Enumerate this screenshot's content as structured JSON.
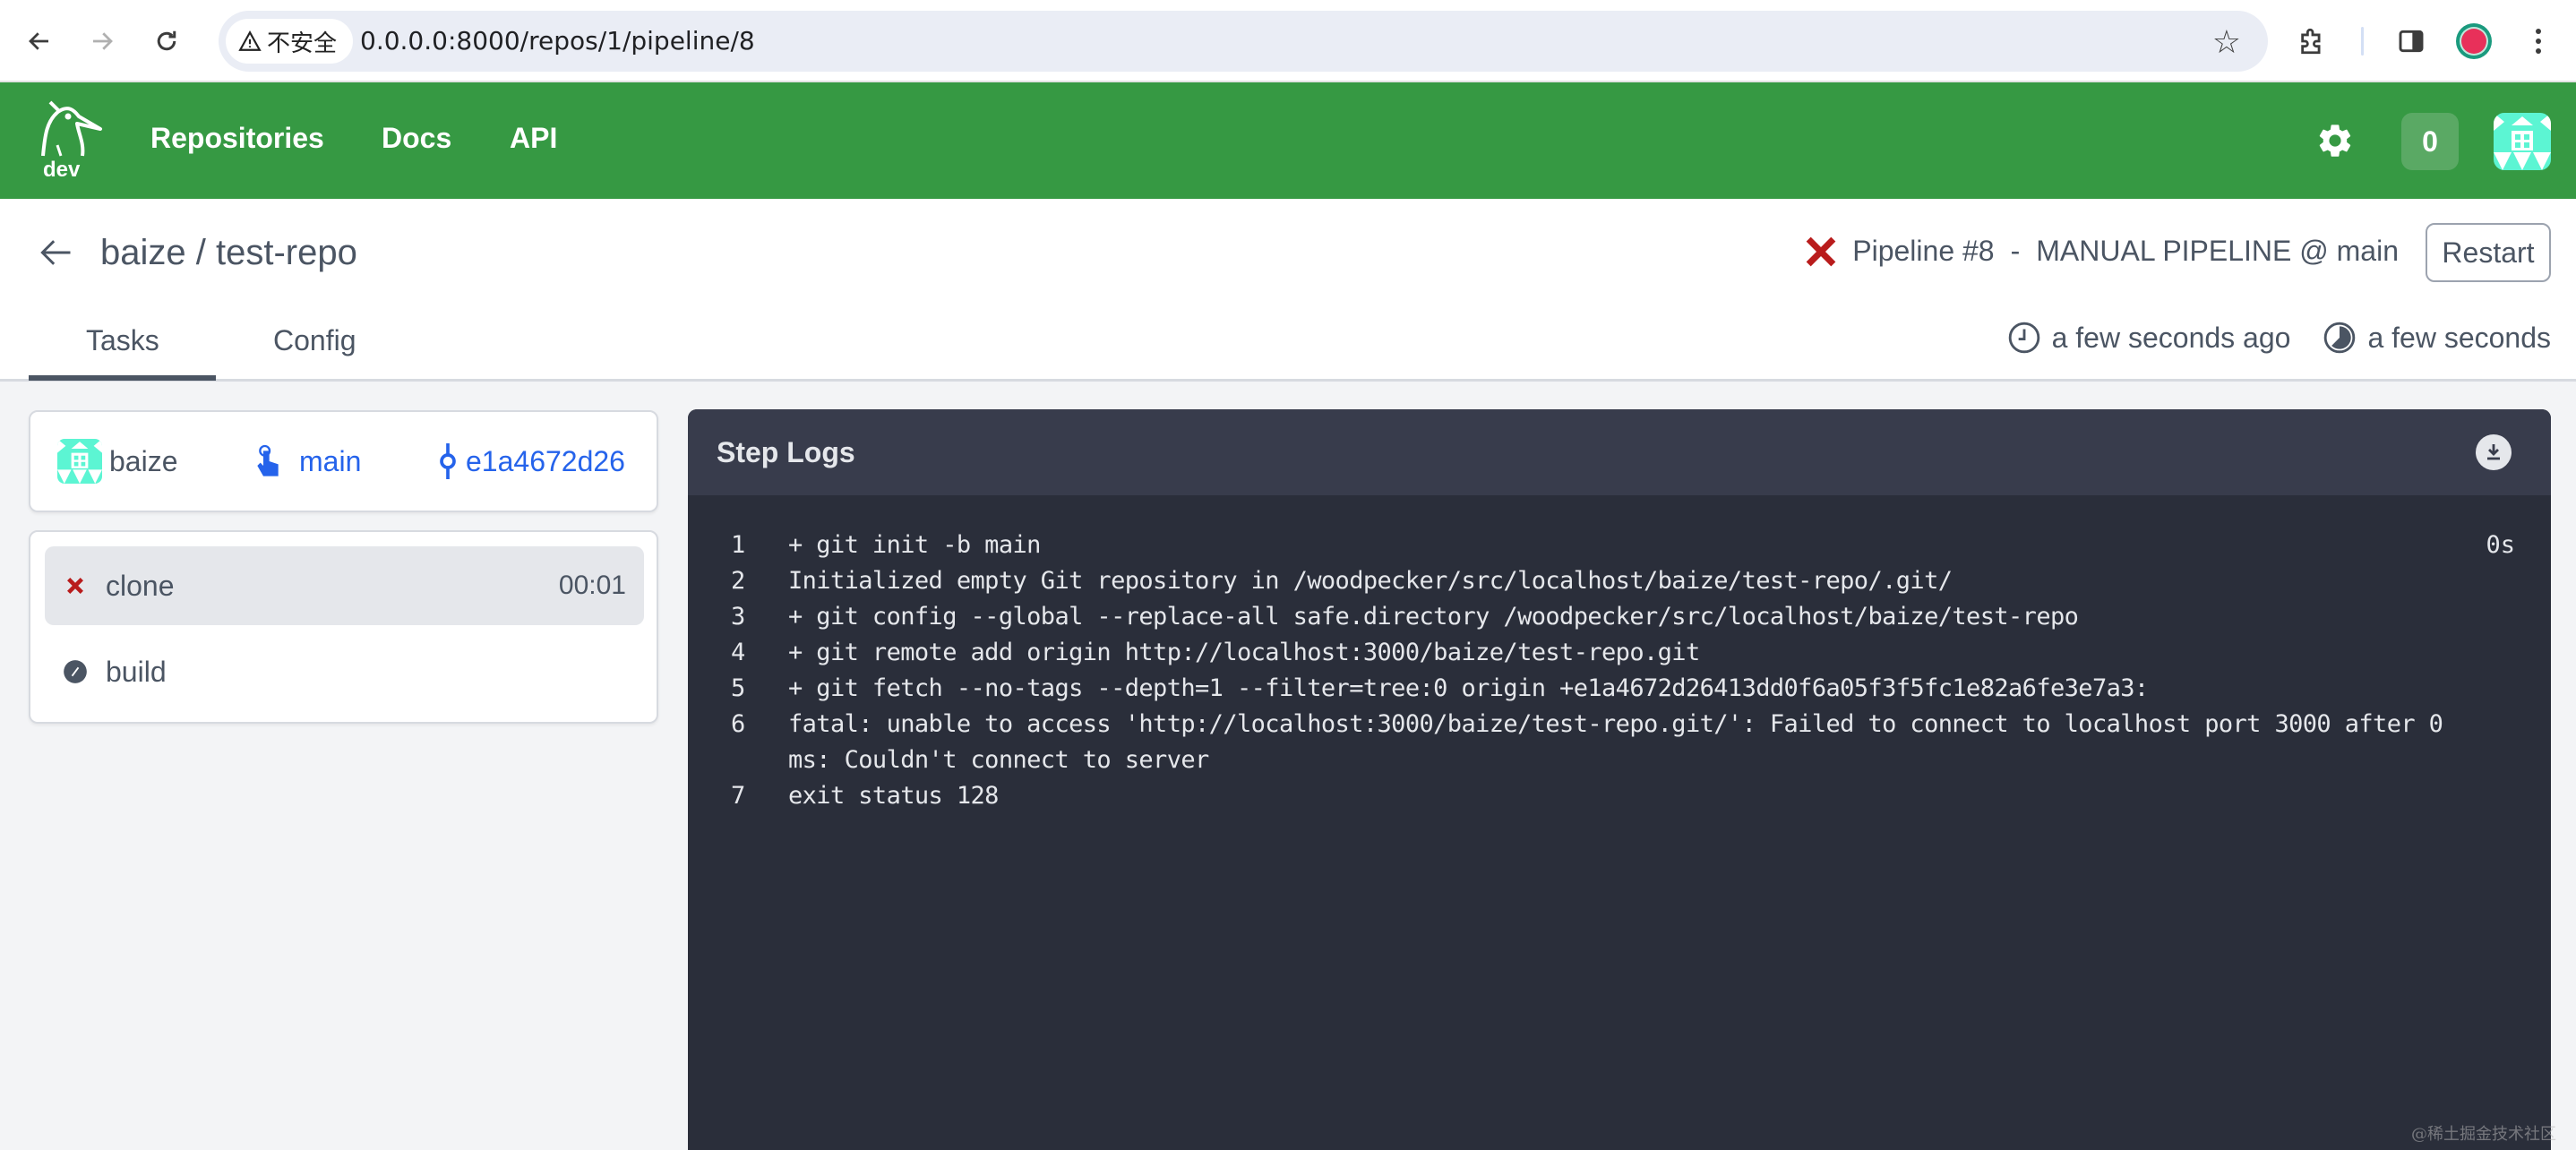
{
  "browser": {
    "security_label": "不安全",
    "url": "0.0.0.0:8000/repos/1/pipeline/8"
  },
  "nav": {
    "logo_label": "dev",
    "links": [
      {
        "label": "Repositories"
      },
      {
        "label": "Docs"
      },
      {
        "label": "API"
      }
    ],
    "notification_count": "0",
    "brand_color": "#369943"
  },
  "header": {
    "repo_title": "baize / test-repo",
    "pipeline_status": "failure",
    "pipeline_label": "Pipeline #8",
    "pipeline_separator": "-",
    "pipeline_event": "MANUAL PIPELINE @ main",
    "restart_label": "Restart",
    "tabs": [
      {
        "label": "Tasks",
        "active": true
      },
      {
        "label": "Config",
        "active": false
      }
    ],
    "created": "a few seconds ago",
    "duration": "a few seconds"
  },
  "info": {
    "author": "baize",
    "branch": "main",
    "commit": "e1a4672d26"
  },
  "steps": [
    {
      "name": "clone",
      "status": "failure",
      "time": "00:01",
      "active": true
    },
    {
      "name": "build",
      "status": "skipped",
      "time": "",
      "active": false
    }
  ],
  "logs": {
    "title": "Step Logs",
    "lines": [
      {
        "num": "1",
        "text": "+ git init -b main",
        "time": "0s"
      },
      {
        "num": "2",
        "text": "Initialized empty Git repository in /woodpecker/src/localhost/baize/test-repo/.git/",
        "time": ""
      },
      {
        "num": "3",
        "text": "+ git config --global --replace-all safe.directory /woodpecker/src/localhost/baize/test-repo",
        "time": ""
      },
      {
        "num": "4",
        "text": "+ git remote add origin http://localhost:3000/baize/test-repo.git",
        "time": ""
      },
      {
        "num": "5",
        "text": "+ git fetch --no-tags --depth=1 --filter=tree:0 origin +e1a4672d26413dd0f6a05f3f5fc1e82a6fe3e7a3:",
        "time": ""
      },
      {
        "num": "6",
        "text": "fatal: unable to access 'http://localhost:3000/baize/test-repo.git/': Failed to connect to localhost port 3000 after 0 ms: Couldn't connect to server",
        "time": ""
      },
      {
        "num": "7",
        "text": "exit status 128",
        "time": ""
      }
    ]
  },
  "colors": {
    "failure": "#b91c1c",
    "link": "#2563eb",
    "log_bg": "#2a2e3a",
    "log_header_bg": "#383c4c"
  },
  "watermark": "@稀土掘金技术社区"
}
